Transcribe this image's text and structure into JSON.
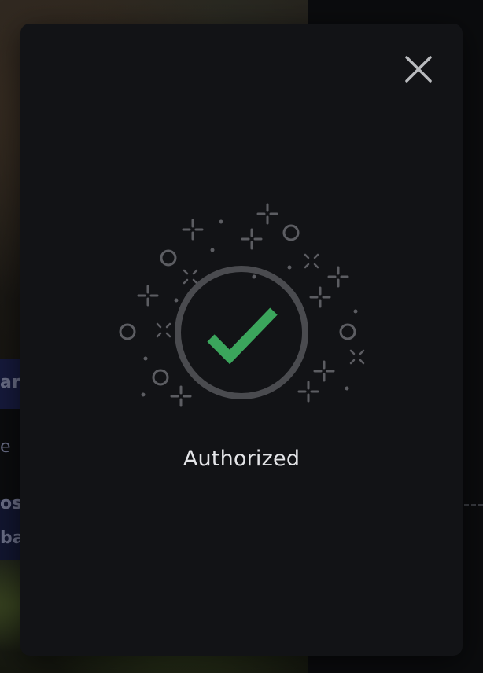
{
  "modal": {
    "status": "Authorized",
    "close_icon": "close-icon",
    "success_icon": "checkmark-circle-icon"
  },
  "background": {
    "snippets": [
      "ar",
      "e",
      "osh",
      "ba"
    ]
  },
  "colors": {
    "modal_bg": "#121316",
    "ring": "#4a4b4f",
    "check": "#3ba55c",
    "sparkle": "#5c5d62",
    "text": "#e4e5e8"
  }
}
